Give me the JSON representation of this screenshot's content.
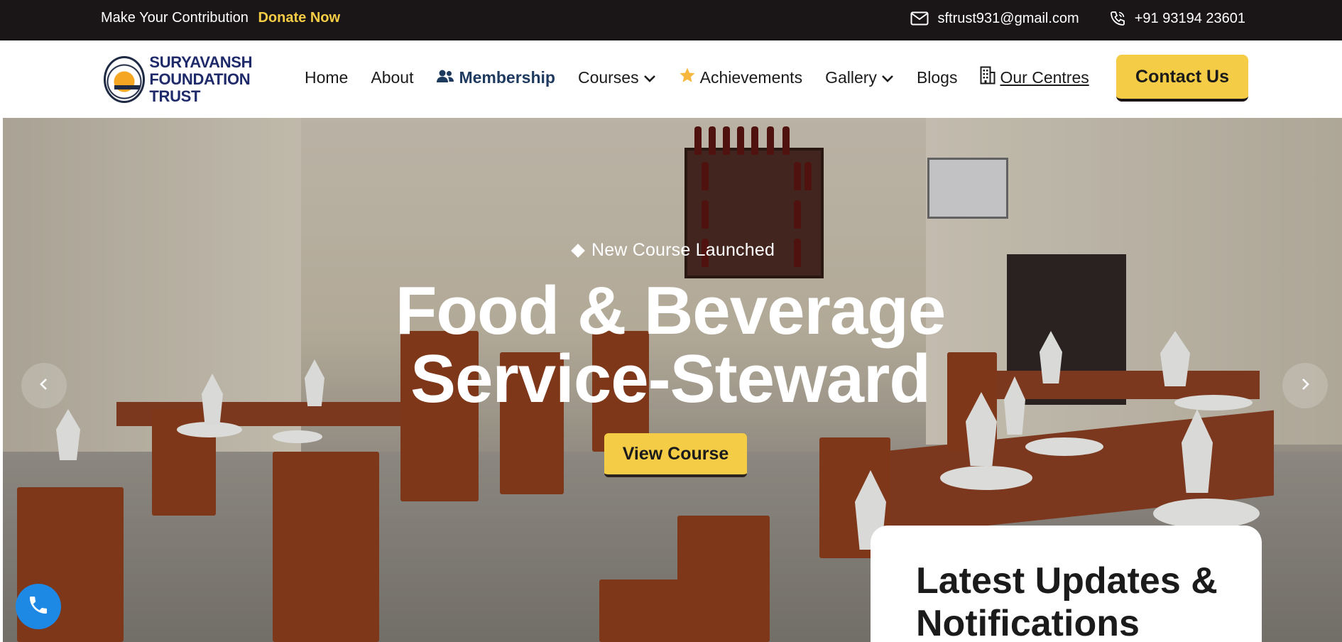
{
  "topbar": {
    "contribution_text": "Make Your Contribution",
    "donate_label": "Donate Now",
    "email": "sftrust931@gmail.com",
    "phone": "+91 93194 23601",
    "icons": [
      "mail-icon",
      "phone-icon"
    ],
    "background": "#1a1617",
    "accent": "#f5cc45"
  },
  "brand": {
    "name_line1": "SURYAVANSH",
    "name_line2": "FOUNDATION TRUST",
    "color": "#1f2a6b"
  },
  "nav": {
    "items": [
      {
        "label": "Home"
      },
      {
        "label": "About"
      },
      {
        "label": "Membership",
        "icon": "users-icon"
      },
      {
        "label": "Courses",
        "icon": "chevron-down-icon"
      },
      {
        "label": "Achievements",
        "icon": "star-icon"
      },
      {
        "label": "Gallery",
        "icon": "chevron-down-icon"
      },
      {
        "label": "Blogs"
      },
      {
        "label": "Our Centres",
        "icon": "building-icon"
      }
    ],
    "contact_label": "Contact Us"
  },
  "hero": {
    "tag": "New Course Launched",
    "title": "Food & Beverage Service-Steward",
    "cta_label": "View Course",
    "prev_icon": "chevron-left-icon",
    "next_icon": "chevron-right-icon"
  },
  "updates": {
    "title": "Latest Updates & Notifications"
  },
  "fab": {
    "icon": "phone-icon",
    "color": "#1e88e5"
  }
}
